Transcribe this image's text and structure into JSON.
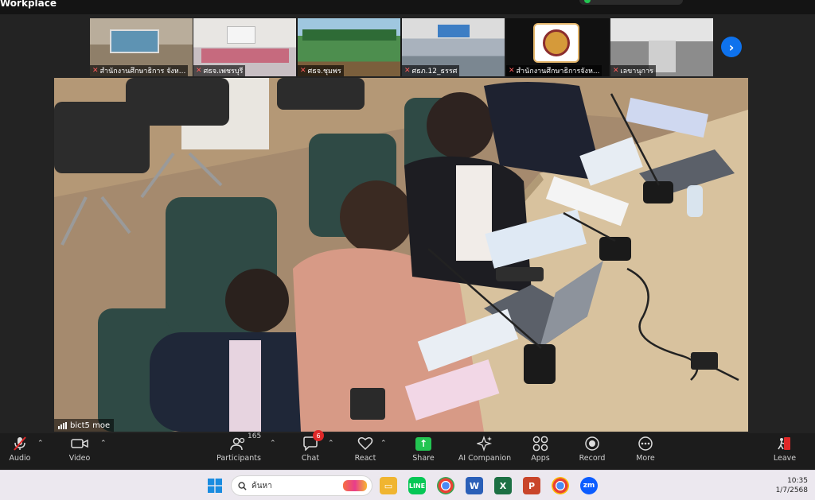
{
  "window": {
    "title": "Workplace"
  },
  "thumbnails": [
    {
      "label": "สำนักงานศึกษาธิการ จังห..."
    },
    {
      "label": "ศธจ.เพชรบุรี"
    },
    {
      "label": "ศธจ.ชุมพร"
    },
    {
      "label": "ศธภ.12_ธรรศ"
    },
    {
      "label": "สำนักงานศึกษาธิการจังห..."
    },
    {
      "label": "เลขานุการ"
    }
  ],
  "active_speaker": {
    "label": "bict5 moe"
  },
  "toolbar": {
    "audio": "Audio",
    "video": "Video",
    "participants": "Participants",
    "participants_count": "165",
    "chat": "Chat",
    "chat_badge": "6",
    "react": "React",
    "share": "Share",
    "ai_companion": "AI Companion",
    "apps": "Apps",
    "record": "Record",
    "more": "More",
    "leave": "Leave"
  },
  "taskbar": {
    "search_placeholder": "ค้นหา",
    "time": "10:35",
    "date": "1/7/2568"
  },
  "colors": {
    "accent": "#0e72ed",
    "share_green": "#23c552",
    "muted_red": "#e02828"
  }
}
